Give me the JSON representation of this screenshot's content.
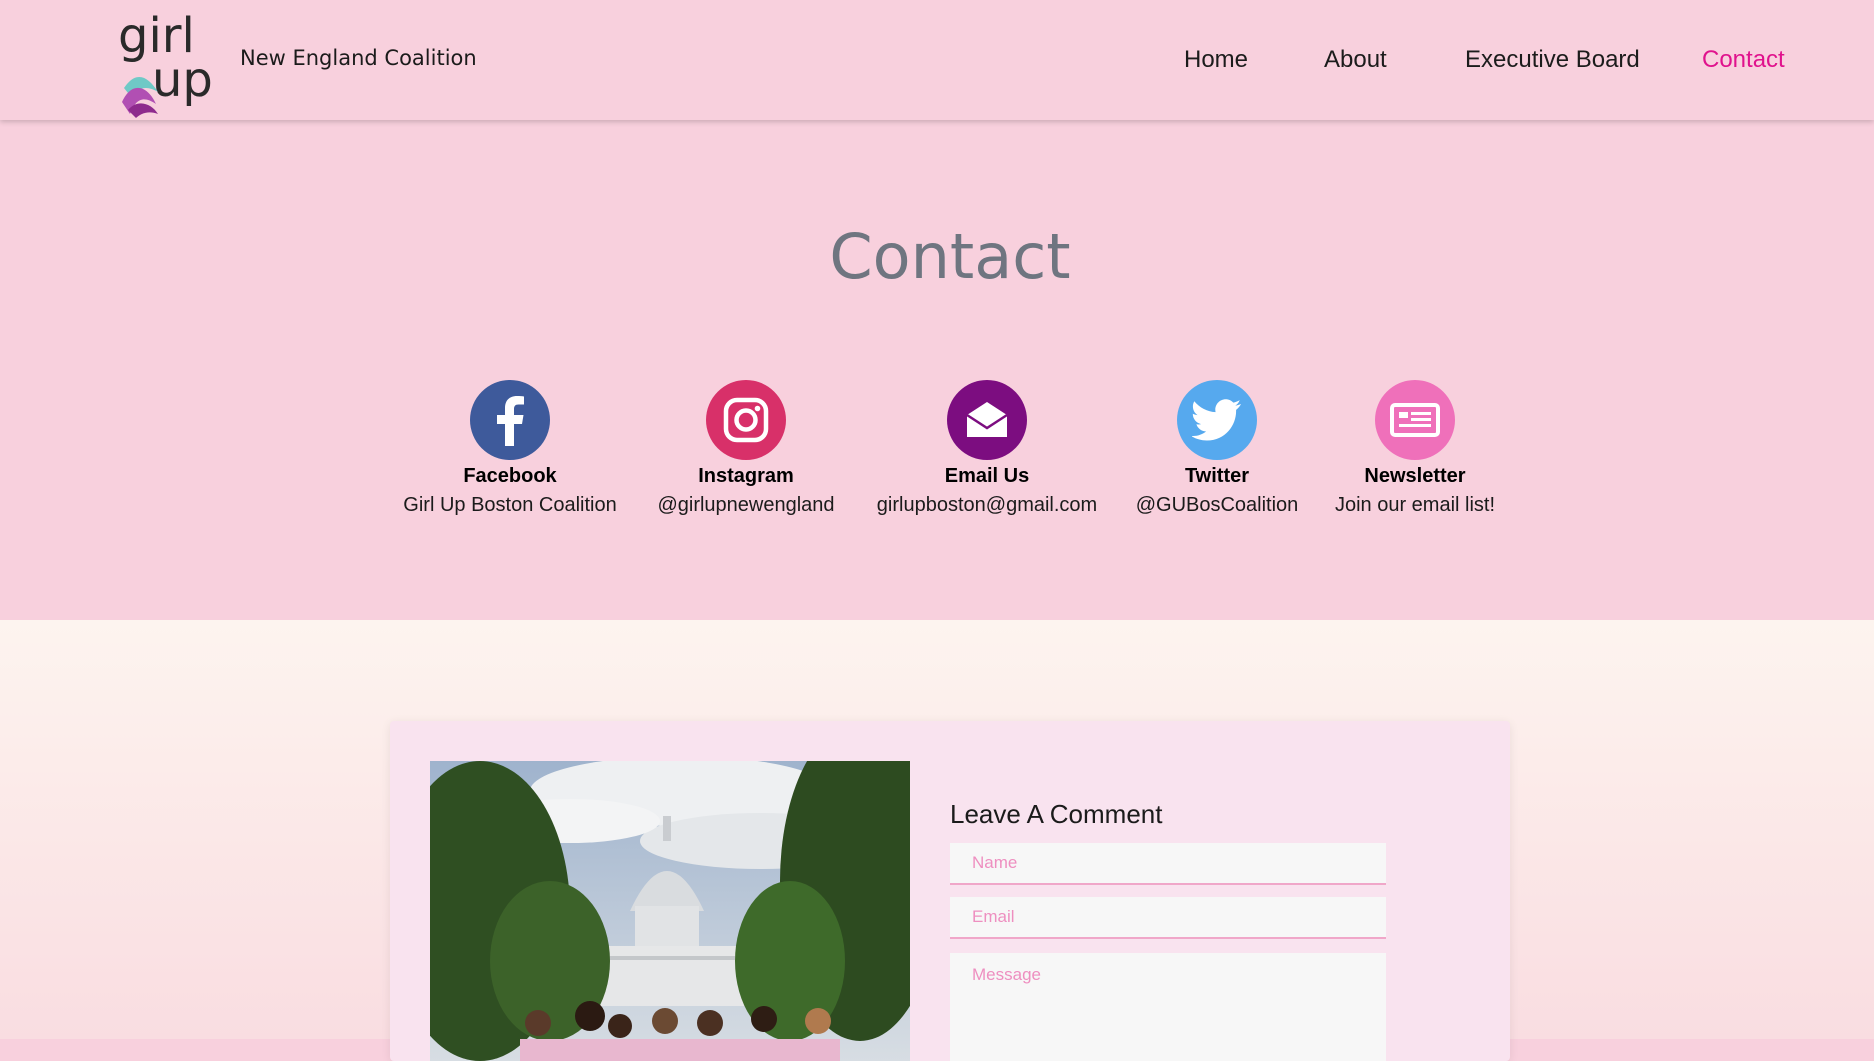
{
  "header": {
    "logo_text": "girl up",
    "brand_name": "New England Coalition",
    "nav": [
      {
        "label": "Home",
        "active": false
      },
      {
        "label": "About",
        "active": false
      },
      {
        "label": "Executive Board",
        "active": false
      },
      {
        "label": "Contact",
        "active": true
      }
    ]
  },
  "contact": {
    "title": "Contact",
    "items": [
      {
        "label": "Facebook",
        "value": "Girl Up Boston Coalition",
        "icon": "facebook-icon",
        "color": "#3b5998"
      },
      {
        "label": "Instagram",
        "value": "@girlupnewengland",
        "icon": "instagram-icon",
        "color": "#d6336c"
      },
      {
        "label": "Email Us",
        "value": "girlupboston@gmail.com",
        "icon": "envelope-icon",
        "color": "#7a0f7e"
      },
      {
        "label": "Twitter",
        "value": "@GUBosCoalition",
        "icon": "twitter-icon",
        "color": "#55acee"
      },
      {
        "label": "Newsletter",
        "value": "Join our email list!",
        "icon": "newspaper-icon",
        "color": "#ef6fb7"
      }
    ]
  },
  "comment_form": {
    "title": "Leave A Comment",
    "name_placeholder": "Name",
    "email_placeholder": "Email",
    "message_placeholder": "Message"
  },
  "colors": {
    "page_background": "#f8d0dd",
    "accent": "#e0128d",
    "title_gray": "#6f7580",
    "card_background": "#f9e3ef"
  }
}
